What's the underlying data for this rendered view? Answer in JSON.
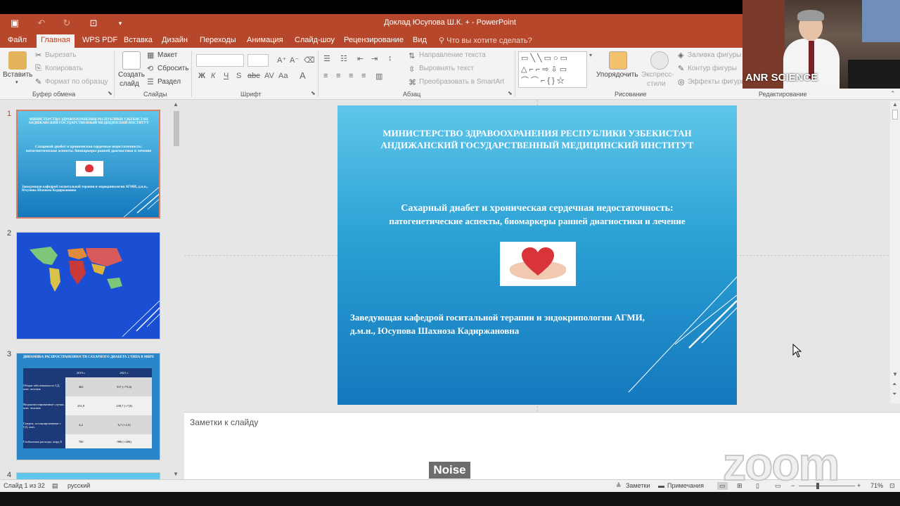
{
  "window": {
    "title": "Доклад  Юсупова Ш.К. + - PowerPoint"
  },
  "tabs": [
    "Файл",
    "Главная",
    "WPS PDF",
    "Вставка",
    "Дизайн",
    "Переходы",
    "Анимация",
    "Слайд-шоу",
    "Рецензирование",
    "Вид"
  ],
  "tell_me": "Что вы хотите сделать?",
  "ribbon": {
    "clipboard": {
      "paste": "Вставить",
      "cut": "Вырезать",
      "copy": "Копировать",
      "format_painter": "Формат по образцу",
      "label": "Буфер обмена"
    },
    "slides": {
      "new_slide_line1": "Создать",
      "new_slide_line2": "слайд",
      "layout": "Макет",
      "reset": "Сбросить",
      "section": "Раздел",
      "label": "Слайды"
    },
    "font": {
      "label": "Шрифт"
    },
    "paragraph": {
      "text_direction": "Направление текста",
      "align_text": "Выровнять текст",
      "smartart": "Преобразовать в SmartArt",
      "label": "Абзац"
    },
    "drawing": {
      "arrange": "Упорядочить",
      "quick_styles_line1": "Экспресс-",
      "quick_styles_line2": "стили",
      "shape_fill": "Заливка фигуры",
      "shape_outline": "Контур фигуры",
      "shape_effects": "Эффекты фигуры",
      "label": "Рисование"
    },
    "editing": {
      "label": "Редактирование"
    }
  },
  "webcam": {
    "label": "ANR SCIENCE"
  },
  "thumbnails": [
    {
      "number": "1"
    },
    {
      "number": "2"
    },
    {
      "number": "3"
    },
    {
      "number": "4"
    }
  ],
  "thumb1": {
    "title": "МИНИСТЕРСТВО ЗДРАВООХРАНЕНИЯ РЕСПУБЛИКИ УЗБЕКИСТАН АНДИЖАНСКИЙ ГОСУДАРСТВЕННЫЙ МЕДИЦИНСКИЙ ИНСТИТУТ",
    "subtitle": "Сахарный диабет и хроническая сердечная недостаточность: патогенетические аспекты, биомаркеры ранней диагностики и лечение",
    "author": "Заведующая кафедрой госпитальной терапии и эндокринологии АГМИ, д.м.н., Юсупова Шахноза Кадиржановна"
  },
  "thumb3": {
    "title": "ДИНАМИКА РАСПРОСТРАНЕННОСТИ САХАРНОГО ДИАБЕТА 2 ТИПА В МИРЕ",
    "headers": [
      "",
      "2019 г.",
      "2021 г."
    ],
    "rows": [
      [
        "Общая заболеваемость СД, млн. человек",
        "463",
        "537 (+73,6)"
      ],
      [
        "Недиагностированные случаи, млн. человек",
        "231,9",
        "239,7 (+7,8)"
      ],
      [
        "Смерти, ассоциированные с СД, млн.",
        "4,2",
        "6,7 (+2,5)"
      ],
      [
        "Глобальные расходы, млрд $",
        "760",
        "966 (+206)"
      ]
    ]
  },
  "slide": {
    "header_line1": "МИНИСТЕРСТВО ЗДРАВООХРАНЕНИЯ РЕСПУБЛИКИ УЗБЕКИСТАН",
    "header_line2": "АНДИЖАНСКИЙ  ГОСУДАРСТВЕННЫЙ  МЕДИЦИНСКИЙ  ИНСТИТУТ",
    "title_line1": "Сахарный диабет и хроническая сердечная недостаточность:",
    "title_line2": "патогенетические аспекты, биомаркеры ранней диагностики и лечение",
    "author_line1": "Заведующая кафедрой госитальной терапии и эндокрипологии АГМИ,",
    "author_line2": "д.м.н., Юсупова Шахноза Кадиржановна"
  },
  "notes": {
    "placeholder": "Заметки к слайду"
  },
  "status": {
    "slide_counter": "Слайд 1 из 32",
    "language": "русский",
    "notes_btn": "Заметки",
    "comments_btn": "Примечания",
    "zoom": "71%"
  },
  "overlay": {
    "noise": "Noise",
    "zoom_logo": "zoom"
  },
  "colors": {
    "accent": "#b7472a",
    "slide_top": "#5fc6ea",
    "slide_bottom": "#1478bd"
  }
}
